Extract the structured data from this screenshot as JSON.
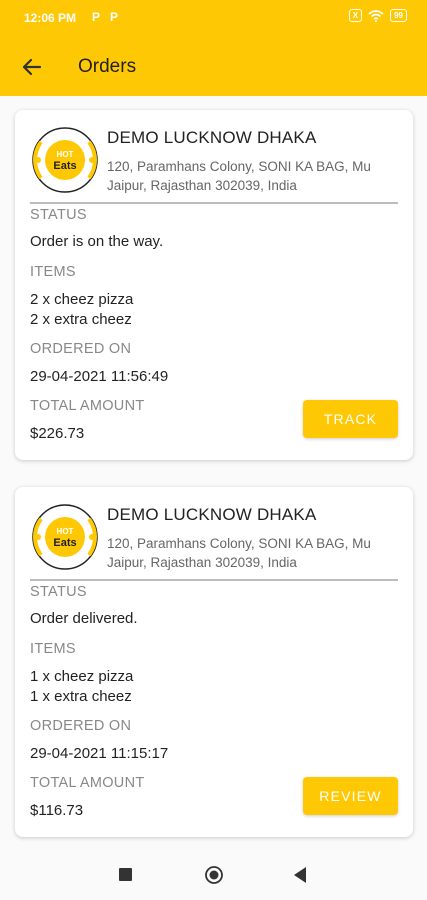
{
  "status_bar": {
    "time": "12:06 PM",
    "notif_1": "P",
    "notif_2": "P",
    "box_icon": "X",
    "battery": "99"
  },
  "header": {
    "title": "Orders",
    "back_icon": "arrow-left-icon"
  },
  "orders": [
    {
      "restaurant": "DEMO LUCKNOW DHAKA",
      "address_line1": "120, Paramhans Colony, SONI KA BAG, Mu",
      "address_line2": "Jaipur, Rajasthan 302039, India",
      "status_label": "STATUS",
      "status": "Order is on the way.",
      "items_label": "ITEMS",
      "item1": "2 x cheez pizza",
      "item2": "2 x extra cheez",
      "ordered_label": "ORDERED ON",
      "ordered_on": "29-04-2021 11:56:49",
      "total_label": "TOTAL AMOUNT",
      "total": "$226.73",
      "action": "TRACK"
    },
    {
      "restaurant": "DEMO LUCKNOW DHAKA",
      "address_line1": "120, Paramhans Colony, SONI KA BAG, Mu",
      "address_line2": "Jaipur, Rajasthan 302039, India",
      "status_label": "STATUS",
      "status": "Order delivered.",
      "items_label": "ITEMS",
      "item1": "1 x cheez pizza",
      "item2": "1 x extra cheez",
      "ordered_label": "ORDERED ON",
      "ordered_on": "29-04-2021 11:15:17",
      "total_label": "TOTAL AMOUNT",
      "total": "$116.73",
      "action": "REVIEW"
    }
  ],
  "logo": {
    "line1": "HOT",
    "line2": "Eats"
  },
  "colors": {
    "accent": "#ffc805"
  }
}
